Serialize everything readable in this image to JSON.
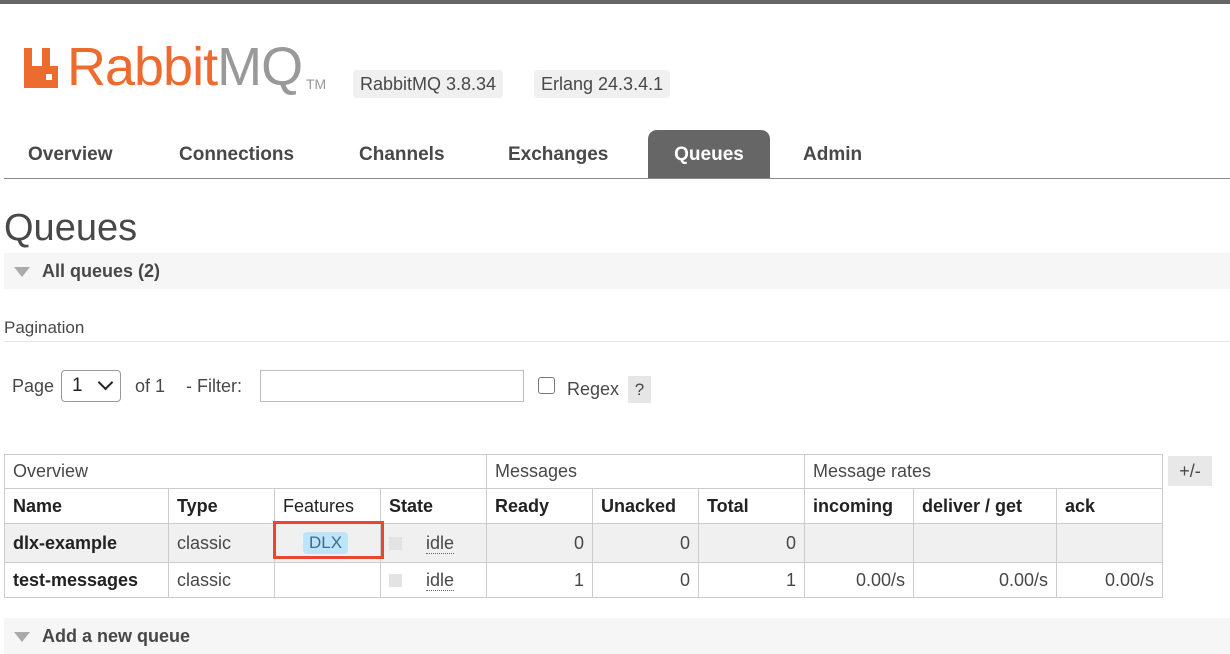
{
  "header": {
    "logo_word_rabbit": "Rabbit",
    "logo_word_mq": "MQ",
    "logo_tm": "TM",
    "version_rabbitmq": "RabbitMQ 3.8.34",
    "version_erlang": "Erlang 24.3.4.1"
  },
  "tabs": [
    {
      "label": "Overview"
    },
    {
      "label": "Connections"
    },
    {
      "label": "Channels"
    },
    {
      "label": "Exchanges"
    },
    {
      "label": "Queues",
      "active": true
    },
    {
      "label": "Admin"
    }
  ],
  "page": {
    "title": "Queues",
    "all_queues_section": "All queues (2)",
    "pagination_label": "Pagination",
    "page_label": "Page",
    "page_value": "1",
    "of_pages": "of 1",
    "filter_label": "- Filter:",
    "filter_value": "",
    "regex_label": "Regex",
    "regex_checked": false,
    "help_label": "?",
    "add_queue_section": "Add a new queue",
    "plus_minus": "+/-"
  },
  "table": {
    "groups": [
      "Overview",
      "Messages",
      "Message rates"
    ],
    "columns": [
      "Name",
      "Type",
      "Features",
      "State",
      "Ready",
      "Unacked",
      "Total",
      "incoming",
      "deliver / get",
      "ack"
    ],
    "rows": [
      {
        "name": "dlx-example",
        "type": "classic",
        "features": "DLX",
        "state": "idle",
        "ready": "0",
        "unacked": "0",
        "total": "0",
        "incoming": "",
        "deliver_get": "",
        "ack": ""
      },
      {
        "name": "test-messages",
        "type": "classic",
        "features": "",
        "state": "idle",
        "ready": "1",
        "unacked": "0",
        "total": "1",
        "incoming": "0.00/s",
        "deliver_get": "0.00/s",
        "ack": "0.00/s"
      }
    ]
  },
  "colors": {
    "brand_orange": "#ee6b2f",
    "tab_active_bg": "#666666",
    "highlight_red": "#e8462f",
    "feature_badge_bg": "#bde4f8"
  }
}
